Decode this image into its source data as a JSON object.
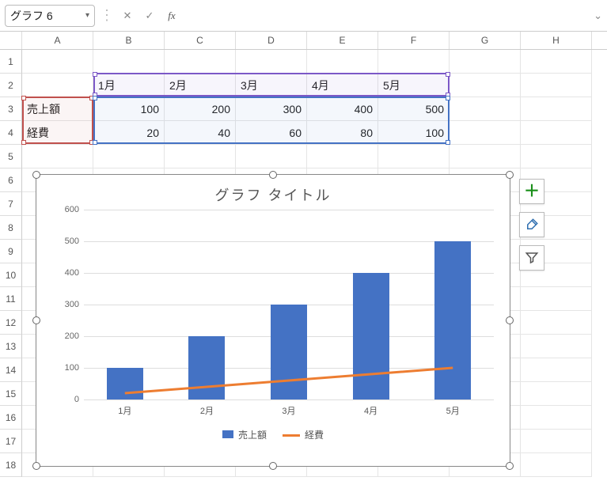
{
  "name_box": "グラフ 6",
  "formula": "",
  "columns": [
    "A",
    "B",
    "C",
    "D",
    "E",
    "F",
    "G",
    "H"
  ],
  "row_numbers": [
    1,
    2,
    3,
    4,
    5,
    6,
    7,
    8,
    9,
    10,
    11,
    12,
    13,
    14,
    15,
    16,
    17,
    18
  ],
  "table": {
    "header_row": [
      "1月",
      "2月",
      "3月",
      "4月",
      "5月"
    ],
    "rows": [
      {
        "label": "売上額",
        "values": [
          100,
          200,
          300,
          400,
          500
        ]
      },
      {
        "label": "経費",
        "values": [
          20,
          40,
          60,
          80,
          100
        ]
      }
    ]
  },
  "chart_data": {
    "type": "bar",
    "title": "グラフ タイトル",
    "categories": [
      "1月",
      "2月",
      "3月",
      "4月",
      "5月"
    ],
    "series": [
      {
        "name": "売上額",
        "type": "bar",
        "values": [
          100,
          200,
          300,
          400,
          500
        ],
        "color": "#4472c4"
      },
      {
        "name": "経費",
        "type": "line",
        "values": [
          20,
          40,
          60,
          80,
          100
        ],
        "color": "#ed7d31"
      }
    ],
    "xlabel": "",
    "ylabel": "",
    "ylim": [
      0,
      600
    ],
    "yticks": [
      0,
      100,
      200,
      300,
      400,
      500,
      600
    ],
    "grid": true,
    "legend_position": "bottom"
  },
  "chart_side_buttons": {
    "add_element": "＋",
    "style": "brush",
    "filter": "funnel"
  }
}
